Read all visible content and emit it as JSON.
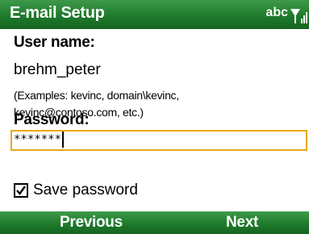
{
  "title_bar": {
    "title": "E-mail Setup",
    "input_mode": "abc",
    "signal_icon": "signal-strength-icon"
  },
  "form": {
    "username_label": "User name:",
    "username_value": "brehm_peter",
    "hint_line1": "(Examples: kevinc, domain\\kevinc,",
    "hint_line2": "kevinc@contoso.com, etc.)",
    "password_label": "Password:",
    "password_value": "*******",
    "save_password_label": "Save password",
    "save_password_checked": true
  },
  "softkeys": {
    "left": "Previous",
    "right": "Next"
  },
  "colors": {
    "bar_green": "#1f7a2c",
    "focus_orange": "#e8a81c"
  }
}
